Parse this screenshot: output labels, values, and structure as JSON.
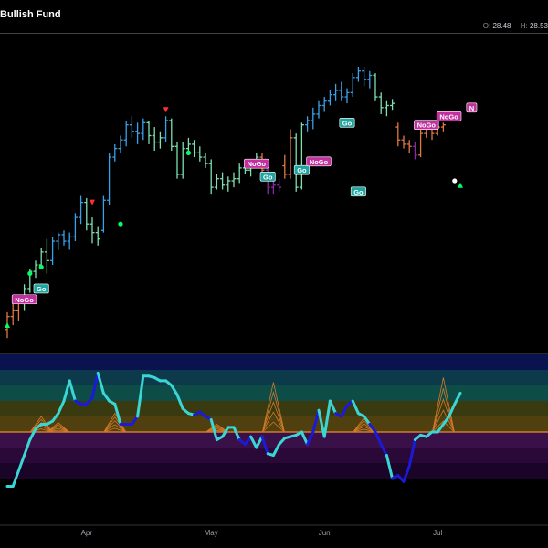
{
  "header": {
    "title": "Bullish Fund",
    "ohlc": [
      {
        "label": "O:",
        "value": "28.48"
      },
      {
        "label": "H:",
        "value": "28.53"
      }
    ]
  },
  "colors": {
    "strong_go": "#3aa0e8",
    "weak_go": "#7ee0b0",
    "weak_nogo": "#e07840",
    "strong_nogo": "#8a2aa0",
    "go_badge": "#1fa5a0",
    "nogo_badge": "#c42fa0",
    "oscillator_go": "#3ad6d6",
    "oscillator_nogo": "#1a1ad8",
    "zero_line": "#d27a2a"
  },
  "chart_data": [
    {
      "type": "bar",
      "title": "Bullish Fund",
      "x_ticks": [
        "Apr",
        "May",
        "Jun",
        "Jul"
      ],
      "ylim": [
        15.5,
        30
      ],
      "bars": [
        [
          0,
          16.4,
          17.2,
          16.0,
          17.0,
          "weak_nogo"
        ],
        [
          1,
          17.0,
          17.6,
          16.6,
          17.3,
          "weak_nogo"
        ],
        [
          2,
          17.3,
          17.9,
          16.8,
          17.6,
          "weak_nogo"
        ],
        [
          3,
          17.6,
          18.5,
          17.3,
          18.3,
          "weak_go"
        ],
        [
          4,
          18.3,
          19.2,
          18.1,
          19.1,
          "weak_go"
        ],
        [
          5,
          19.1,
          19.6,
          18.8,
          19.4,
          "weak_go"
        ],
        [
          6,
          19.4,
          20.2,
          19.2,
          20.0,
          "weak_go"
        ],
        [
          7,
          20.0,
          20.6,
          19.0,
          19.6,
          "weak_go"
        ],
        [
          8,
          19.6,
          20.7,
          19.4,
          20.5,
          "strong_go"
        ],
        [
          9,
          20.5,
          20.9,
          20.1,
          20.8,
          "strong_go"
        ],
        [
          10,
          20.8,
          21.0,
          20.3,
          20.5,
          "strong_go"
        ],
        [
          11,
          20.5,
          20.9,
          20.1,
          20.7,
          "strong_go"
        ],
        [
          12,
          20.7,
          21.8,
          20.5,
          21.6,
          "strong_go"
        ],
        [
          13,
          21.6,
          22.6,
          21.3,
          22.3,
          "strong_go"
        ],
        [
          14,
          22.3,
          22.5,
          21.0,
          21.3,
          "weak_go"
        ],
        [
          15,
          21.3,
          21.6,
          20.4,
          20.9,
          "weak_go"
        ],
        [
          16,
          20.9,
          21.2,
          20.3,
          20.6,
          "weak_go"
        ],
        [
          17,
          21.0,
          22.6,
          20.9,
          22.4,
          "strong_go"
        ],
        [
          18,
          22.4,
          24.6,
          22.2,
          24.4,
          "strong_go"
        ],
        [
          19,
          24.4,
          25.0,
          24.2,
          24.8,
          "strong_go"
        ],
        [
          20,
          24.8,
          25.4,
          24.6,
          25.2,
          "strong_go"
        ],
        [
          21,
          25.2,
          26.1,
          24.9,
          25.9,
          "strong_go"
        ],
        [
          22,
          25.9,
          26.3,
          25.3,
          25.6,
          "strong_go"
        ],
        [
          23,
          25.6,
          26.0,
          25.0,
          25.5,
          "strong_go"
        ],
        [
          24,
          25.5,
          26.2,
          25.2,
          26.0,
          "strong_go"
        ],
        [
          25,
          26.0,
          26.1,
          25.0,
          25.4,
          "weak_go"
        ],
        [
          26,
          25.4,
          25.8,
          24.7,
          25.1,
          "weak_go"
        ],
        [
          27,
          25.1,
          25.6,
          24.8,
          25.3,
          "weak_go"
        ],
        [
          28,
          25.3,
          26.3,
          25.1,
          26.1,
          "strong_go"
        ],
        [
          29,
          26.1,
          26.2,
          24.7,
          24.9,
          "weak_go"
        ],
        [
          30,
          24.9,
          25.1,
          23.4,
          23.6,
          "weak_go"
        ],
        [
          31,
          23.6,
          25.1,
          23.4,
          24.8,
          "weak_go"
        ],
        [
          32,
          24.8,
          25.3,
          24.5,
          25.0,
          "weak_go"
        ],
        [
          33,
          25.0,
          25.2,
          24.4,
          24.6,
          "weak_go"
        ],
        [
          34,
          24.6,
          24.9,
          24.2,
          24.4,
          "weak_go"
        ],
        [
          35,
          24.4,
          24.6,
          23.9,
          24.1,
          "weak_go"
        ],
        [
          36,
          24.1,
          24.3,
          22.7,
          23.0,
          "weak_go"
        ],
        [
          37,
          23.0,
          23.6,
          22.9,
          23.4,
          "weak_go"
        ],
        [
          38,
          23.4,
          23.7,
          22.9,
          23.1,
          "weak_go"
        ],
        [
          39,
          23.1,
          23.5,
          22.8,
          23.3,
          "weak_go"
        ],
        [
          40,
          23.3,
          23.7,
          23.0,
          23.4,
          "weak_go"
        ],
        [
          41,
          23.4,
          24.1,
          23.2,
          23.9,
          "weak_go"
        ],
        [
          42,
          23.9,
          24.2,
          23.6,
          23.8,
          "weak_go"
        ],
        [
          43,
          23.8,
          24.2,
          23.5,
          24.0,
          "weak_go"
        ],
        [
          44,
          24.0,
          24.6,
          23.9,
          24.4,
          "weak_go"
        ],
        [
          45,
          24.4,
          24.6,
          23.6,
          23.8,
          "weak_nogo"
        ],
        [
          46,
          23.8,
          23.9,
          22.7,
          23.0,
          "strong_nogo"
        ],
        [
          47,
          23.0,
          23.3,
          22.7,
          23.1,
          "strong_nogo"
        ],
        [
          48,
          23.1,
          23.4,
          22.8,
          23.0,
          "strong_nogo"
        ],
        [
          49,
          24.0,
          24.5,
          23.4,
          23.6,
          "weak_nogo"
        ],
        [
          50,
          23.6,
          25.7,
          23.4,
          25.3,
          "weak_nogo"
        ],
        [
          51,
          25.3,
          25.5,
          22.8,
          23.0,
          "weak_go"
        ],
        [
          52,
          23.0,
          26.0,
          22.9,
          25.9,
          "weak_go"
        ],
        [
          53,
          25.9,
          26.3,
          25.6,
          26.1,
          "strong_go"
        ],
        [
          54,
          26.1,
          26.7,
          25.7,
          26.4,
          "strong_go"
        ],
        [
          55,
          26.4,
          27.0,
          26.2,
          26.8,
          "strong_go"
        ],
        [
          56,
          26.8,
          27.2,
          26.5,
          27.0,
          "strong_go"
        ],
        [
          57,
          27.0,
          27.5,
          26.8,
          27.3,
          "strong_go"
        ],
        [
          58,
          27.3,
          27.8,
          27.0,
          27.5,
          "strong_go"
        ],
        [
          59,
          27.5,
          27.9,
          27.0,
          27.2,
          "strong_go"
        ],
        [
          60,
          27.2,
          27.6,
          26.9,
          27.4,
          "strong_go"
        ],
        [
          61,
          27.4,
          28.3,
          27.2,
          28.1,
          "strong_go"
        ],
        [
          62,
          28.1,
          28.6,
          27.9,
          28.4,
          "strong_go"
        ],
        [
          63,
          28.4,
          28.6,
          27.7,
          28.0,
          "strong_go"
        ],
        [
          64,
          28.0,
          28.4,
          27.6,
          28.2,
          "strong_go"
        ],
        [
          65,
          28.2,
          28.3,
          27.0,
          27.2,
          "weak_go"
        ],
        [
          66,
          27.2,
          27.4,
          26.4,
          26.7,
          "weak_go"
        ],
        [
          67,
          26.7,
          27.0,
          26.3,
          26.8,
          "weak_go"
        ],
        [
          68,
          26.8,
          27.1,
          26.6,
          26.9,
          "weak_go"
        ],
        [
          69,
          25.8,
          26.0,
          24.9,
          25.2,
          "weak_nogo"
        ],
        [
          70,
          25.2,
          25.4,
          24.8,
          25.0,
          "weak_nogo"
        ],
        [
          71,
          25.0,
          25.2,
          24.6,
          24.9,
          "weak_nogo"
        ],
        [
          72,
          24.9,
          25.1,
          24.3,
          24.5,
          "strong_nogo"
        ],
        [
          73,
          24.5,
          25.7,
          24.4,
          25.5,
          "weak_nogo"
        ],
        [
          74,
          25.5,
          25.9,
          25.3,
          25.7,
          "weak_nogo"
        ],
        [
          75,
          25.7,
          25.9,
          25.2,
          25.5,
          "weak_nogo"
        ],
        [
          76,
          25.5,
          26.0,
          25.4,
          25.8,
          "weak_nogo"
        ],
        [
          77,
          25.8,
          26.0,
          25.6,
          25.9,
          "weak_nogo"
        ]
      ],
      "labels": [
        {
          "text": "NoGo",
          "type": "nogo",
          "bar": 3,
          "price": 17.8
        },
        {
          "text": "Go",
          "type": "go",
          "bar": 6,
          "price": 18.3
        },
        {
          "text": "NoGo",
          "type": "nogo",
          "bar": 44,
          "price": 24.1
        },
        {
          "text": "Go",
          "type": "go",
          "bar": 46,
          "price": 23.5
        },
        {
          "text": "Go",
          "type": "go",
          "bar": 52,
          "price": 23.8
        },
        {
          "text": "NoGo",
          "type": "nogo",
          "bar": 55,
          "price": 24.2
        },
        {
          "text": "Go",
          "type": "go",
          "bar": 60,
          "price": 26.0
        },
        {
          "text": "Go",
          "type": "go",
          "bar": 62,
          "price": 22.8
        },
        {
          "text": "NoGo",
          "type": "nogo",
          "bar": 74,
          "price": 25.9
        },
        {
          "text": "NoGo",
          "type": "nogo",
          "bar": 78,
          "price": 26.3
        },
        {
          "text": "N",
          "type": "nogo",
          "bar": 82,
          "price": 26.7
        }
      ],
      "markers": [
        {
          "shape": "triangle-up",
          "color": "#00ff66",
          "bar": 0,
          "price": 16.6
        },
        {
          "shape": "dot",
          "color": "#00ff66",
          "bar": 4,
          "price": 19.0
        },
        {
          "shape": "dot",
          "color": "#00ff66",
          "bar": 6,
          "price": 19.3
        },
        {
          "shape": "triangle-down",
          "color": "#ff3030",
          "bar": 15,
          "price": 22.3
        },
        {
          "shape": "dot",
          "color": "#00ff66",
          "bar": 20,
          "price": 21.3
        },
        {
          "shape": "triangle-down",
          "color": "#ff3030",
          "bar": 28,
          "price": 26.6
        },
        {
          "shape": "dot",
          "color": "#00ff66",
          "bar": 32,
          "price": 24.6
        },
        {
          "shape": "triangle-up",
          "color": "#00ff66",
          "bar": 80,
          "price": 23.1
        },
        {
          "shape": "dot",
          "color": "#ffffff",
          "bar": 79,
          "price": 23.3
        }
      ]
    },
    {
      "type": "line",
      "name": "oscillator",
      "ylim": [
        -6,
        5
      ],
      "bands": [
        4,
        3,
        2,
        1,
        0,
        -1,
        -2,
        -3
      ],
      "values": [
        -3.5,
        -3.5,
        -2.5,
        -1.5,
        -0.5,
        0.2,
        0.5,
        0.5,
        0.7,
        1.2,
        2.0,
        3.3,
        2.0,
        1.8,
        1.8,
        2.2,
        3.8,
        2.5,
        2.0,
        1.8,
        0.5,
        0.5,
        0.5,
        1.0,
        3.6,
        3.6,
        3.5,
        3.3,
        3.3,
        3.0,
        2.4,
        1.5,
        1.2,
        1.1,
        1.3,
        1.0,
        0.8,
        -0.5,
        -0.3,
        0.3,
        0.3,
        -0.5,
        -0.8,
        -0.3,
        -1.0,
        -0.3,
        -1.4,
        -1.5,
        -0.8,
        -0.4,
        -0.3,
        -0.2,
        0.0,
        -0.8,
        0.0,
        1.4,
        -0.3,
        2.0,
        1.2,
        1.0,
        1.7,
        2.0,
        1.2,
        1.0,
        0.5,
        0.0,
        -0.8,
        -1.5,
        -3.0,
        -2.8,
        -3.2,
        -2.2,
        -0.5,
        -0.2,
        -0.3,
        0.0,
        0.0,
        0.5,
        1.0,
        1.8,
        2.5
      ],
      "go_flags": [
        1,
        1,
        1,
        1,
        1,
        1,
        1,
        1,
        1,
        1,
        1,
        1,
        0,
        0,
        0,
        0,
        1,
        1,
        1,
        1,
        0,
        0,
        0,
        1,
        1,
        1,
        1,
        1,
        1,
        1,
        1,
        1,
        1,
        0,
        0,
        0,
        1,
        1,
        1,
        1,
        1,
        0,
        0,
        1,
        1,
        0,
        1,
        1,
        1,
        1,
        1,
        1,
        1,
        0,
        0,
        1,
        1,
        1,
        0,
        0,
        0,
        1,
        1,
        1,
        0,
        0,
        0,
        1,
        0,
        0,
        0,
        0,
        1,
        1,
        1,
        1,
        1,
        1,
        1,
        1,
        1
      ],
      "histogram_peaks": [
        {
          "bar": 6,
          "value": 1.0
        },
        {
          "bar": 9,
          "value": 0.6
        },
        {
          "bar": 19,
          "value": 1.2
        },
        {
          "bar": 37,
          "value": 0.5
        },
        {
          "bar": 47,
          "value": 3.2
        },
        {
          "bar": 63,
          "value": 0.9
        },
        {
          "bar": 77,
          "value": 3.5
        }
      ]
    }
  ]
}
